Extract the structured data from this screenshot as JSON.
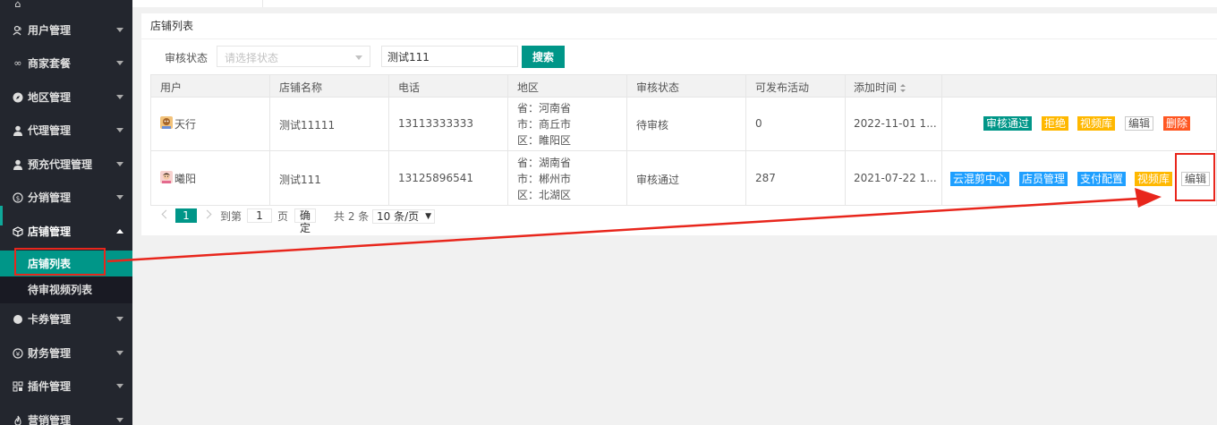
{
  "sidebar": {
    "items": [
      {
        "label": "用户管理",
        "icon": "user-group-icon"
      },
      {
        "label": "商家套餐",
        "icon": "infinity-icon"
      },
      {
        "label": "地区管理",
        "icon": "compass-icon"
      },
      {
        "label": "代理管理",
        "icon": "person-icon"
      },
      {
        "label": "预充代理管理",
        "icon": "person-icon"
      },
      {
        "label": "分销管理",
        "icon": "coin-icon"
      },
      {
        "label": "店铺管理",
        "icon": "cube-icon"
      },
      {
        "label": "卡券管理",
        "icon": "circle-icon"
      },
      {
        "label": "财务管理",
        "icon": "yen-icon"
      },
      {
        "label": "插件管理",
        "icon": "apps-icon"
      },
      {
        "label": "营销管理",
        "icon": "fire-icon"
      }
    ],
    "sub_items": [
      {
        "label": "店铺列表"
      },
      {
        "label": "待审视频列表"
      }
    ]
  },
  "panel": {
    "title": "店铺列表",
    "filter": {
      "status_label": "审核状态",
      "status_placeholder": "请选择状态",
      "keyword_value": "测试111",
      "search_label": "搜索"
    }
  },
  "table": {
    "columns": [
      "用户",
      "店铺名称",
      "电话",
      "地区",
      "审核状态",
      "可发布活动",
      "添加时间"
    ],
    "rows": [
      {
        "user": "天行",
        "shop": "测试11111",
        "phone": "13113333333",
        "region": [
          "省：河南省",
          "市：商丘市",
          "区：睢阳区"
        ],
        "status": "待审核",
        "activities": "0",
        "time": "2022-11-01 1...",
        "actions": [
          {
            "label": "审核通过",
            "color": "#009688"
          },
          {
            "label": "拒绝",
            "color": "#ffb800"
          },
          {
            "label": "视频库",
            "color": "#ffb800"
          },
          {
            "label": "编辑",
            "color": "#ffffff"
          },
          {
            "label": "删除",
            "color": "#ff5722"
          }
        ]
      },
      {
        "user": "曦阳",
        "shop": "测试111",
        "phone": "13125896541",
        "region": [
          "省：湖南省",
          "市：郴州市",
          "区：北湖区"
        ],
        "status": "审核通过",
        "activities": "287",
        "time": "2021-07-22 1...",
        "actions": [
          {
            "label": "云混剪中心",
            "color": "#1e9fff"
          },
          {
            "label": "店员管理",
            "color": "#1e9fff"
          },
          {
            "label": "支付配置",
            "color": "#1e9fff"
          },
          {
            "label": "视频库",
            "color": "#ffb800"
          },
          {
            "label": "编辑",
            "color": "#ffffff"
          }
        ]
      }
    ]
  },
  "pager": {
    "current": "1",
    "goto_label": "到第",
    "goto_value": "1",
    "page_unit": "页",
    "confirm": "确定",
    "total": "共 2 条",
    "page_size": "10 条/页"
  },
  "colors": {
    "sidebar_bg": "#23262e",
    "accent": "#009688",
    "annotation": "#e8261c"
  }
}
